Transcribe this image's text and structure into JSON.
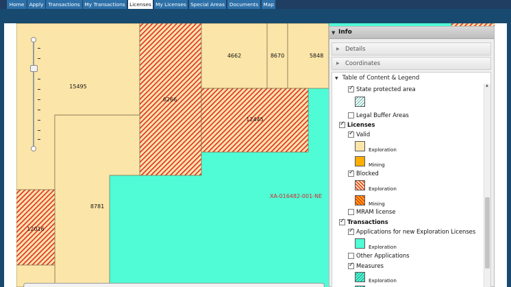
{
  "nav": {
    "tabs": [
      "Home",
      "Apply",
      "Transactions",
      "My Transactions",
      "Licenses",
      "My Licenses",
      "Special Areas",
      "Documents",
      "Map"
    ],
    "active": "Licenses"
  },
  "map": {
    "plots": [
      {
        "id": "15495",
        "label": "15495",
        "status": "valid-exploration"
      },
      {
        "id": "6266",
        "label": "6266",
        "status": "blocked-exploration"
      },
      {
        "id": "4662",
        "label": "4662",
        "status": "valid-exploration"
      },
      {
        "id": "8670",
        "label": "8670",
        "status": "valid-exploration"
      },
      {
        "id": "5848",
        "label": "5848",
        "status": "valid-exploration"
      },
      {
        "id": "12445",
        "label": "12445",
        "status": "blocked-exploration"
      },
      {
        "id": "8781",
        "label": "8781",
        "status": "valid-exploration"
      },
      {
        "id": "12016",
        "label": "12016",
        "status": "blocked-exploration"
      },
      {
        "id": "app",
        "label": "XA-016482-001-NE",
        "status": "application-exploration"
      }
    ],
    "colors": {
      "exploration": "#fbe5a8",
      "mining": "#ffae00",
      "blocked_hatch": "#e2302c",
      "application": "#4ffcd6",
      "application_label": "#d6262a"
    }
  },
  "info": {
    "title": "Info",
    "sections": [
      "Details",
      "Coordinates"
    ],
    "toc_title": "Table of Content & Legend",
    "legend": {
      "state_protected": "State protected area",
      "legal_buffer": "Legal Buffer Areas",
      "licenses": "Licenses",
      "valid": "Valid",
      "exploration": "Exploration",
      "mining": "Mining",
      "blocked": "Blocked",
      "mram": "MRAM license",
      "transactions": "Transactions",
      "applications": "Applications for new Exploration Licenses",
      "other_apps": "Other Applications",
      "measures": "Measures"
    }
  },
  "icons": [
    "triangle-down-icon",
    "triangle-right-icon",
    "checkbox-icon",
    "scroll-up-icon"
  ]
}
